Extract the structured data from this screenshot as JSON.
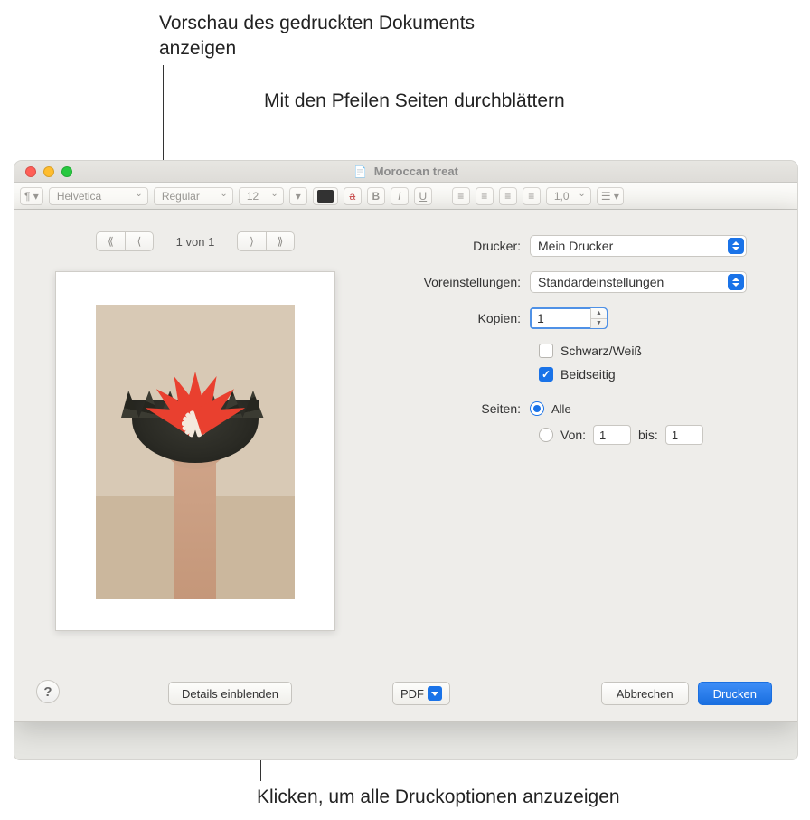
{
  "callouts": {
    "preview": "Vorschau des gedruckten Dokuments anzeigen",
    "arrows": "Mit den Pfeilen Seiten durchblättern",
    "details": "Klicken, um alle Druckoptionen anzuzeigen"
  },
  "window": {
    "title": "Moroccan treat"
  },
  "toolbar": {
    "font_family": "Helvetica",
    "font_style": "Regular",
    "font_size": "12",
    "bold": "B",
    "italic": "I",
    "underline": "U",
    "line_spacing": "1,0"
  },
  "pager": {
    "indicator": "1 von 1"
  },
  "form": {
    "printer_label": "Drucker:",
    "printer_value": "Mein Drucker",
    "presets_label": "Voreinstellungen:",
    "presets_value": "Standardeinstellungen",
    "copies_label": "Kopien:",
    "copies_value": "1",
    "bw_label": "Schwarz/Weiß",
    "duplex_label": "Beidseitig",
    "pages_label": "Seiten:",
    "pages_all": "Alle",
    "pages_from": "Von:",
    "pages_to": "bis:",
    "pages_from_value": "1",
    "pages_to_value": "1"
  },
  "buttons": {
    "help": "?",
    "details": "Details einblenden",
    "pdf": "PDF",
    "cancel": "Abbrechen",
    "print": "Drucken"
  }
}
